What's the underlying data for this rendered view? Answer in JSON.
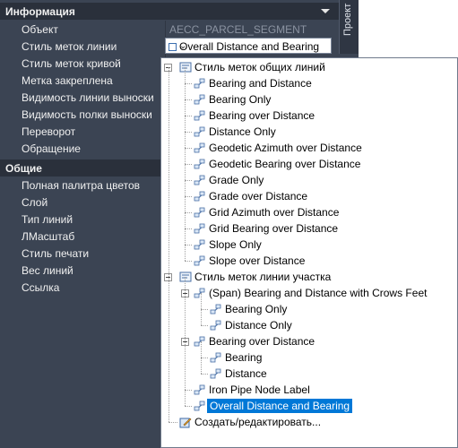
{
  "palette": {
    "section_info": "Информация",
    "section_general": "Общие",
    "info_rows": [
      {
        "label": "Объект",
        "value": "AECC_PARCEL_SEGMENT"
      },
      {
        "label": "Стиль меток линии",
        "value": "Overall Distance and Bearing"
      },
      {
        "label": "Стиль меток кривой",
        "value": ""
      },
      {
        "label": "Метка закреплена",
        "value": ""
      },
      {
        "label": "Видимость линии выноски",
        "value": ""
      },
      {
        "label": "Видимость полки выноски",
        "value": ""
      },
      {
        "label": "Переворот",
        "value": ""
      },
      {
        "label": "Обращение",
        "value": ""
      }
    ],
    "general_rows": [
      {
        "label": "Полная палитра цветов"
      },
      {
        "label": "Слой"
      },
      {
        "label": "Тип линий"
      },
      {
        "label": "ЛМасштаб"
      },
      {
        "label": "Стиль печати"
      },
      {
        "label": "Вес линий"
      },
      {
        "label": "Ссылка"
      }
    ]
  },
  "side_tab": "Проект",
  "tree": {
    "group1": {
      "label": "Стиль меток общих линий",
      "items": [
        "Bearing and Distance",
        "Bearing Only",
        "Bearing over Distance",
        "Distance Only",
        "Geodetic Azimuth over Distance",
        "Geodetic Bearing over Distance",
        "Grade Only",
        "Grade over Distance",
        "Grid Azimuth over Distance",
        "Grid Bearing over Distance",
        "Slope Only",
        "Slope over Distance"
      ]
    },
    "group2": {
      "label": "Стиль меток линии участка",
      "span": {
        "label": "(Span)  Bearing and Distance with Crows Feet",
        "children": [
          "Bearing Only",
          "Distance Only"
        ]
      },
      "bod": {
        "label": "Bearing over Distance",
        "children": [
          "Bearing",
          "Distance"
        ]
      },
      "iron": "Iron Pipe Node Label",
      "selected": "Overall Distance and Bearing"
    },
    "create_edit": "Создать/редактировать..."
  },
  "colors": {
    "selection": "#0078d7",
    "panel_bg": "#3b4453",
    "section_bg": "#2a303b"
  }
}
